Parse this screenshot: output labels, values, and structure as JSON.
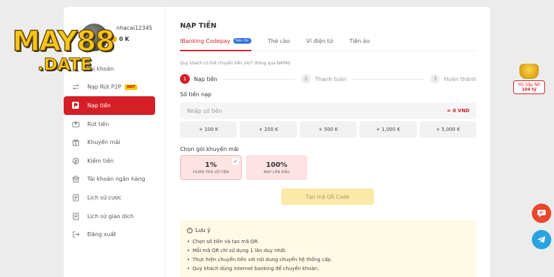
{
  "user": {
    "name": "nhacai12345",
    "balance": "0 K"
  },
  "sidebar": {
    "items": [
      {
        "label": "Tài khoản",
        "icon": "user-icon"
      },
      {
        "label": "Nạp Rút P2P",
        "icon": "exchange-icon",
        "badge": "HOT"
      },
      {
        "label": "Nạp tiền",
        "icon": "deposit-icon",
        "active": true
      },
      {
        "label": "Rút tiền",
        "icon": "withdraw-icon"
      },
      {
        "label": "Khuyến mãi",
        "icon": "gift-icon"
      },
      {
        "label": "Kiếm tiền",
        "icon": "earn-icon"
      },
      {
        "label": "Tài khoản ngân hàng",
        "icon": "bank-icon"
      },
      {
        "label": "Lịch sử cược",
        "icon": "history-icon"
      },
      {
        "label": "Lịch sử giao dịch",
        "icon": "transaction-icon"
      },
      {
        "label": "Đăng xuất",
        "icon": "logout-icon"
      }
    ]
  },
  "main": {
    "title": "NẠP TIỀN",
    "tabs": [
      {
        "label": "IBanking Codepay",
        "badge": "Siêu tốc",
        "active": true
      },
      {
        "label": "Thẻ cào"
      },
      {
        "label": "Ví điện tử"
      },
      {
        "label": "Tiền ảo"
      }
    ],
    "note": "Quý khách có thể chuyển tiền 24/7 thông qua NAPAS",
    "steps": [
      {
        "num": "1",
        "label": "Nạp tiền",
        "active": true
      },
      {
        "num": "2",
        "label": "Thanh toán"
      },
      {
        "num": "3",
        "label": "Hoàn thành"
      }
    ],
    "amount_label": "Số tiền nạp",
    "amount_placeholder": "Nhập số tiền",
    "amount_equiv": "= 0 VND",
    "quick_amounts": [
      "+ 100 K",
      "+ 200 K",
      "+ 500 K",
      "+ 1,000 K",
      "+ 5,000 K"
    ],
    "promo_label": "Chọn gói khuyến mãi",
    "promos": [
      {
        "pct": "1%",
        "desc": "HOÀN TRẢ VÔ TẬN",
        "selected": true
      },
      {
        "pct": "100%",
        "desc": "NẠP LẦN ĐẦU"
      }
    ],
    "qr_button": "Tạo mã QR Code",
    "notice": {
      "title": "Lưu ý",
      "items": [
        "Chọn số tiền và tạo mã QR.",
        "Mỗi mã QR chỉ sử dụng 1 lần duy nhất.",
        "Thực hiện chuyển tiền với nội dung chuyển hệ thống cấp.",
        "Quý khách dùng internet banking để chuyển khoản."
      ]
    }
  },
  "logo": {
    "main": "MAY88",
    "sub": ".DATE"
  },
  "jackpot": {
    "label": "Hũ Sắp Nổ",
    "value": "104 tỷ"
  },
  "colors": {
    "accent": "#d51f26",
    "gold": "#f6c61c",
    "telegram": "#2aa3e0",
    "chat": "#e8472b"
  }
}
